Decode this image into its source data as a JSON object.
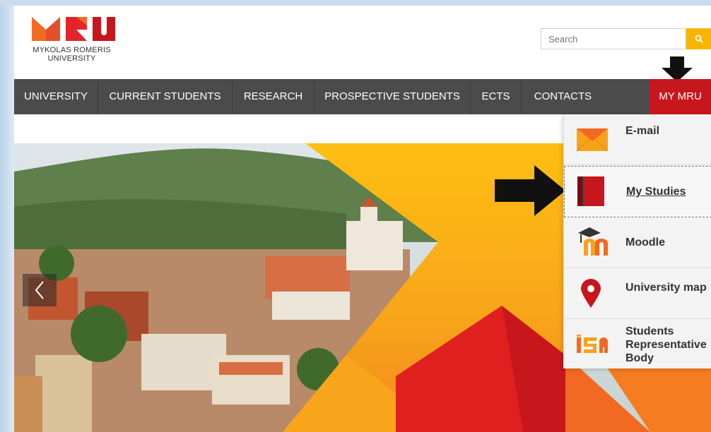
{
  "brand": {
    "logo_text_line1": "MYKOLAS ROMERIS",
    "logo_text_line2": "UNIVERSITY",
    "colors": {
      "orange": "#f26a21",
      "red": "#c8161d",
      "yellow": "#f7b500",
      "nav_bg": "#4b4b4b"
    }
  },
  "search": {
    "placeholder": "Search",
    "icon": "search-icon"
  },
  "nav": {
    "items": [
      {
        "label": "UNIVERSITY"
      },
      {
        "label": "CURRENT STUDENTS"
      },
      {
        "label": "RESEARCH"
      },
      {
        "label": "PROSPECTIVE STUDENTS"
      },
      {
        "label": "ECTS"
      },
      {
        "label": "CONTACTS"
      }
    ],
    "my_mru": "MY MRU"
  },
  "dropdown": {
    "items": [
      {
        "label": "E-mail",
        "icon": "envelope-icon"
      },
      {
        "label": "My Studies",
        "icon": "book-icon"
      },
      {
        "label": "Moodle",
        "icon": "moodle-icon"
      },
      {
        "label": "University map",
        "icon": "map-pin-icon"
      },
      {
        "label_line1": "Students",
        "label_line2": "Representative",
        "label_line3": "Body",
        "icon": "isa-logo-icon"
      }
    ]
  },
  "hero": {
    "prev_icon": "chevron-left-icon"
  }
}
